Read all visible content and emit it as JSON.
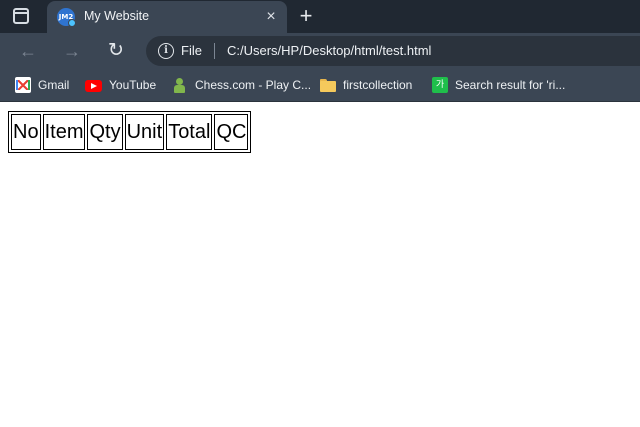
{
  "browser": {
    "tab": {
      "favicon_text": "JM2",
      "title": "My Website",
      "close_glyph": "×"
    },
    "new_tab_glyph": "+",
    "nav": {
      "back_glyph": "←",
      "forward_glyph": "→",
      "reload_glyph": "↻"
    },
    "address_bar": {
      "info_glyph": "i",
      "scheme_label": "File",
      "url": "C:/Users/HP/Desktop/html/test.html"
    },
    "bookmarks": [
      {
        "label": "Gmail",
        "icon": "gmail-icon"
      },
      {
        "label": "YouTube",
        "icon": "youtube-icon"
      },
      {
        "label": "Chess.com - Play C...",
        "icon": "chess-icon"
      },
      {
        "label": "firstcollection",
        "icon": "folder-icon"
      },
      {
        "label": "Search result for 'ri...",
        "icon": "korean-dictionary-icon",
        "icon_text": "가"
      }
    ]
  },
  "page": {
    "table": {
      "headers": [
        "No",
        "Item",
        "Qty",
        "Unit",
        "Total",
        "QC"
      ]
    }
  }
}
